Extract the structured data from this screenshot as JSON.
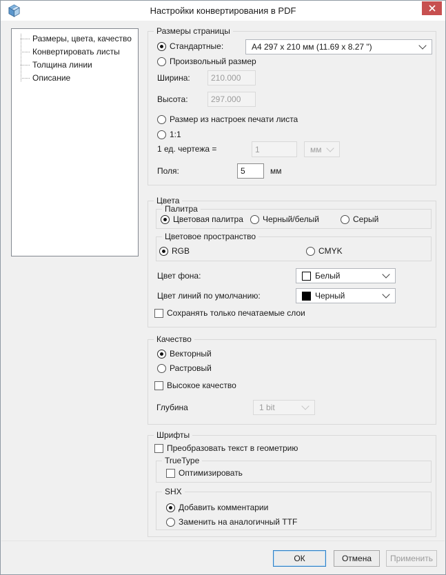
{
  "window": {
    "title": "Настройки конвертирования в PDF"
  },
  "icons": {
    "app": "cube-icon",
    "close": "close-icon",
    "dropdown": "chevron-down-icon"
  },
  "theme": {
    "close_button_red": "#c75050",
    "focus_blue": "#2f80c6",
    "dialog_bg": "#f0f0f0",
    "background_swatch": "#ffffff",
    "lines_swatch": "#000000"
  },
  "tree": {
    "items": [
      "Размеры, цвета, качество",
      "Конвертировать листы",
      "Толщина линии",
      "Описание"
    ]
  },
  "page_size": {
    "group_label": "Размеры страницы",
    "standard_label": "Стандартные:",
    "standard_value": "A4 297 x 210 мм (11.69 x 8.27 \")",
    "custom_label": "Произвольный размер",
    "width_label": "Ширина:",
    "width_value": "210.000",
    "height_label": "Высота:",
    "height_value": "297.000",
    "from_print_label": "Размер из настроек печати листа",
    "one_to_one_label": "1:1",
    "unit_label": "1 ед. чертежа =",
    "unit_value": "1",
    "unit_select_value": "мм",
    "margins_label": "Поля:",
    "margins_value": "5",
    "margins_unit": "мм"
  },
  "colors": {
    "group_label": "Цвета",
    "palette": {
      "label": "Палитра",
      "options": [
        "Цветовая палитра",
        "Черный/белый",
        "Серый"
      ],
      "selected": "Цветовая палитра"
    },
    "space": {
      "label": "Цветовое пространство",
      "options": [
        "RGB",
        "CMYK"
      ],
      "selected": "RGB"
    },
    "background_label": "Цвет фона:",
    "background_value": "Белый",
    "lines_label": "Цвет линий по умолчанию:",
    "lines_value": "Черный",
    "printable_layers_label": "Сохранять только печатаемые слои"
  },
  "quality": {
    "group_label": "Качество",
    "vector_label": "Векторный",
    "raster_label": "Растровый",
    "high_quality_label": "Высокое качество",
    "depth_label": "Глубина",
    "depth_value": "1 bit"
  },
  "fonts": {
    "group_label": "Шрифты",
    "text_to_geometry_label": "Преобразовать текст в геометрию",
    "truetype": {
      "label": "TrueType",
      "optimize_label": "Оптимизировать"
    },
    "shx": {
      "label": "SHX",
      "add_comments_label": "Добавить комментарии",
      "replace_ttf_label": "Заменить на аналогичный TTF"
    }
  },
  "buttons": {
    "ok": "ОК",
    "cancel": "Отмена",
    "apply": "Применить"
  }
}
